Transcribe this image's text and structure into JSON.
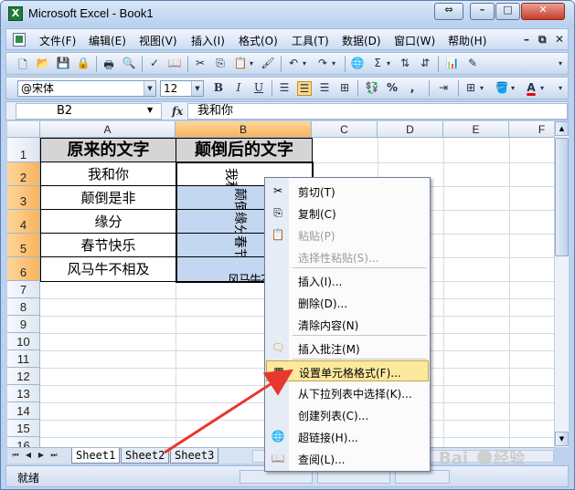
{
  "window": {
    "title": "Microsoft Excel - Book1"
  },
  "menu": {
    "items": [
      "文件(F)",
      "编辑(E)",
      "视图(V)",
      "插入(I)",
      "格式(O)",
      "工具(T)",
      "数据(D)",
      "窗口(W)",
      "帮助(H)"
    ]
  },
  "font_box": {
    "name": "@宋体",
    "size": "12"
  },
  "formula_bar": {
    "cell_ref": "B2",
    "fx": "fx",
    "value": "我和你"
  },
  "columns": [
    "A",
    "B",
    "C",
    "D",
    "E",
    "F"
  ],
  "rows": [
    "1",
    "2",
    "3",
    "4",
    "5",
    "6",
    "7",
    "8",
    "9",
    "10",
    "11",
    "12",
    "13",
    "14",
    "15",
    "16"
  ],
  "table": {
    "header": {
      "a": "原来的文字",
      "b": "颠倒后的文字"
    },
    "rows": [
      {
        "a": "我和你",
        "b": "我和你"
      },
      {
        "a": "颠倒是非",
        "b": "颠倒是非"
      },
      {
        "a": "缘分",
        "b": "缘分"
      },
      {
        "a": "春节快乐",
        "b": "春节快乐"
      },
      {
        "a": "风马牛不相及",
        "b": "风马牛不相及"
      }
    ]
  },
  "sheets": [
    "Sheet1",
    "Sheet2",
    "Sheet3"
  ],
  "status": {
    "text": "就绪"
  },
  "context_menu": {
    "items": [
      {
        "label": "剪切(T)",
        "icon": "cut-icon"
      },
      {
        "label": "复制(C)",
        "icon": "copy-icon"
      },
      {
        "label": "粘贴(P)",
        "icon": "paste-icon"
      },
      {
        "label": "选择性粘贴(S)...",
        "icon": ""
      },
      {
        "label": "插入(I)...",
        "icon": ""
      },
      {
        "label": "删除(D)...",
        "icon": ""
      },
      {
        "label": "清除内容(N)",
        "icon": ""
      },
      {
        "label": "插入批注(M)",
        "icon": "comment-icon"
      },
      {
        "label": "设置单元格格式(F)...",
        "icon": "format-cells-icon"
      },
      {
        "label": "从下拉列表中选择(K)...",
        "icon": ""
      },
      {
        "label": "创建列表(C)...",
        "icon": ""
      },
      {
        "label": "超链接(H)...",
        "icon": "hyperlink-icon"
      },
      {
        "label": "查阅(L)...",
        "icon": "research-icon"
      }
    ]
  },
  "colors": {
    "selection_header": "#f7b35c",
    "menu_highlight": "#fde99e",
    "arrow": "#e8372c"
  }
}
